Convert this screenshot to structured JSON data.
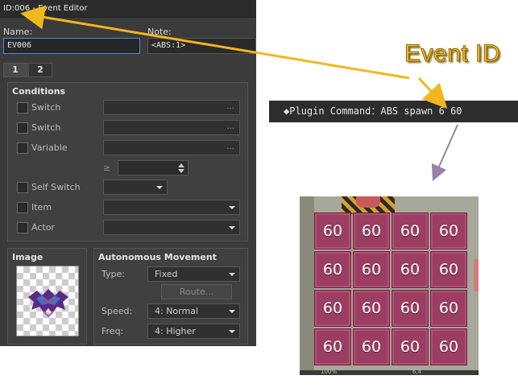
{
  "window": {
    "title": "ID:006 - Event Editor",
    "name_label": "Name:",
    "name_value": "EV006",
    "note_label": "Note:",
    "note_value": "<ABS:1>",
    "tabs": [
      "1",
      "2"
    ]
  },
  "conditions": {
    "title": "Conditions",
    "rows": [
      {
        "label": "Switch",
        "value": "..."
      },
      {
        "label": "Switch",
        "value": "..."
      },
      {
        "label": "Variable",
        "value": "..."
      }
    ],
    "comparator": "≥",
    "self_switch_label": "Self Switch",
    "item_label": "Item",
    "actor_label": "Actor"
  },
  "image": {
    "title": "Image"
  },
  "movement": {
    "title": "Autonomous Movement",
    "type_label": "Type:",
    "type_value": "Fixed",
    "route_button": "Route...",
    "speed_label": "Speed:",
    "speed_value": "4: Normal",
    "freq_label": "Freq:",
    "freq_value": "4: Higher"
  },
  "annotation": {
    "event_id_label": "Event ID",
    "plugin_command": "◆Plugin Command：ABS spawn 6 60",
    "arrow_color": "#f2b71c",
    "arrow2_color": "#9a7fa8"
  },
  "map": {
    "tile_label": "60",
    "tile_rows": 4,
    "tile_cols": 4,
    "footer_left": "100%",
    "footer_right": "6,4"
  },
  "colors": {
    "accent": "#4a8fd8",
    "tile": "#9c3d62",
    "highlight": "#f4c430"
  }
}
